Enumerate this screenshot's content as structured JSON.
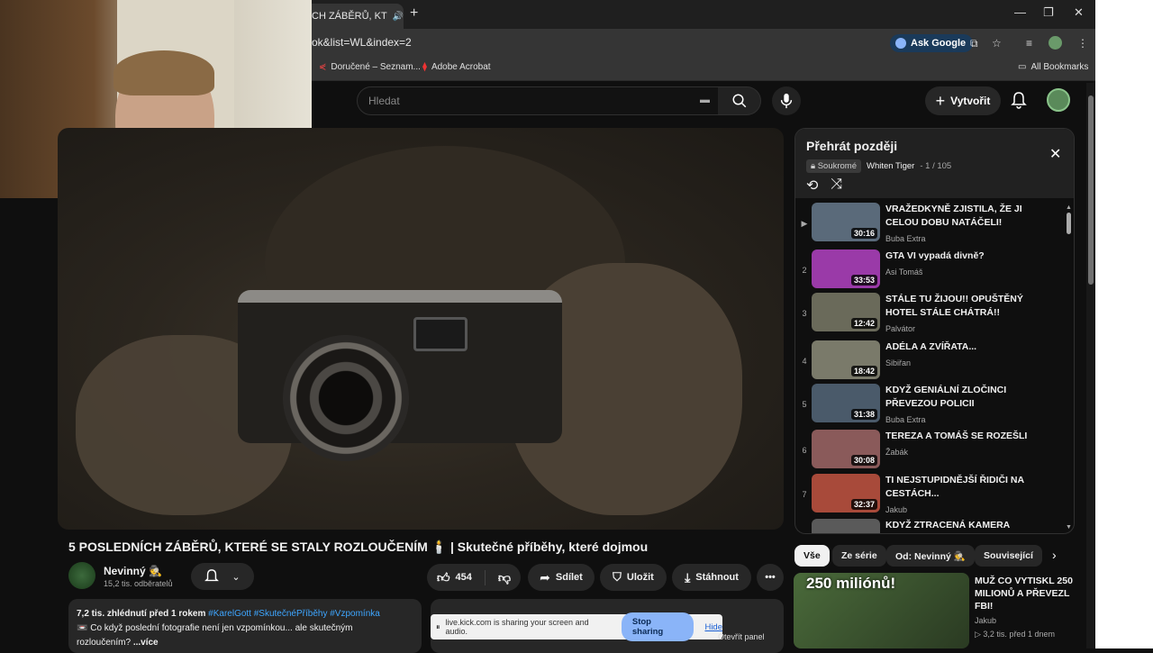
{
  "browser": {
    "tab_title": "CH ZÁBĚRŮ, KT",
    "url": "ok&list=WL&index=2",
    "ask_google": "Ask Google",
    "bookmarks": [
      "Doručené – Seznam...",
      "Adobe Acrobat"
    ],
    "all_bookmarks": "All Bookmarks"
  },
  "header": {
    "search_placeholder": "Hledat",
    "create_label": "Vytvořit"
  },
  "video": {
    "title": "5 POSLEDNÍCH ZÁBĚRŮ, KTERÉ SE STALY ROZLOUČENÍM 🕯️ | Skutečné příběhy, které dojmou",
    "channel": "Nevinný 🕵️",
    "subscribers": "15,2 tis. odběratelů",
    "likes": "454",
    "share": "Sdílet",
    "save": "Uložit",
    "download": "Stáhnout",
    "views_date": "7,2 tis. zhlédnutí  před 1 rokem",
    "hashtags": "#KarelGott #SkutečnéPříběhy #Vzpomínka",
    "desc_line1": "📼 Co když poslední fotografie není jen vzpomínkou... ale skutečným",
    "desc_line2": "rozloučením?",
    "more": "...více"
  },
  "share_notice": {
    "text": "live.kick.com is sharing your screen and audio.",
    "stop": "Stop sharing",
    "hide": "Hide",
    "open_panel": "Otevřít panel"
  },
  "playlist": {
    "title": "Přehrát později",
    "privacy": "Soukromé",
    "owner": "Whiten Tiger",
    "position": "1 / 105",
    "items": [
      {
        "idx": "▶",
        "title": "VRAŽEDKYNĚ ZJISTILA, ŽE JI CELOU DOBU NATÁČELI!",
        "channel": "Buba Extra",
        "duration": "30:16",
        "color": "#5a6a7a"
      },
      {
        "idx": "2",
        "title": "GTA VI vypadá divně?",
        "channel": "Asi Tomáš",
        "duration": "33:53",
        "color": "#9a3aa8"
      },
      {
        "idx": "3",
        "title": "STÁLE TU ŽIJOU!! OPUŠTĚNÝ HOTEL STÁLE CHÁTRÁ!!",
        "channel": "Palvátor",
        "duration": "12:42",
        "color": "#6a6a5a"
      },
      {
        "idx": "4",
        "title": "ADÉLA A ZVÍŘATA...",
        "channel": "Sibiřan",
        "duration": "18:42",
        "color": "#7a7a6a"
      },
      {
        "idx": "5",
        "title": "KDYŽ GENIÁLNÍ ZLOČINCI PŘEVEZOU POLICII",
        "channel": "Buba Extra",
        "duration": "31:38",
        "color": "#4a5a6a"
      },
      {
        "idx": "6",
        "title": "TEREZA A TOMÁŠ SE ROZEŠLI",
        "channel": "Žabák",
        "duration": "30:08",
        "color": "#8a5a5a"
      },
      {
        "idx": "7",
        "title": "TI NEJSTUPIDNĚJŠÍ ŘIDIČI NA CESTÁCH...",
        "channel": "Jakub",
        "duration": "32:37",
        "color": "#a84a3a"
      },
      {
        "idx": "8",
        "title": "KDYŽ ZTRACENÁ KAMERA",
        "channel": "",
        "duration": "",
        "color": "#5a5a5a"
      }
    ]
  },
  "chips": [
    "Vše",
    "Ze série",
    "Od: Nevinný 🕵️",
    "Související"
  ],
  "recommendation": {
    "thumb_text": "250 miliónů!",
    "title": "MUŽ CO VYTISKL 250 MILIONŮ A PŘEVEZL FBI!",
    "channel": "Jakub",
    "views": "▷ 3,2 tis.  před 1 dnem"
  }
}
